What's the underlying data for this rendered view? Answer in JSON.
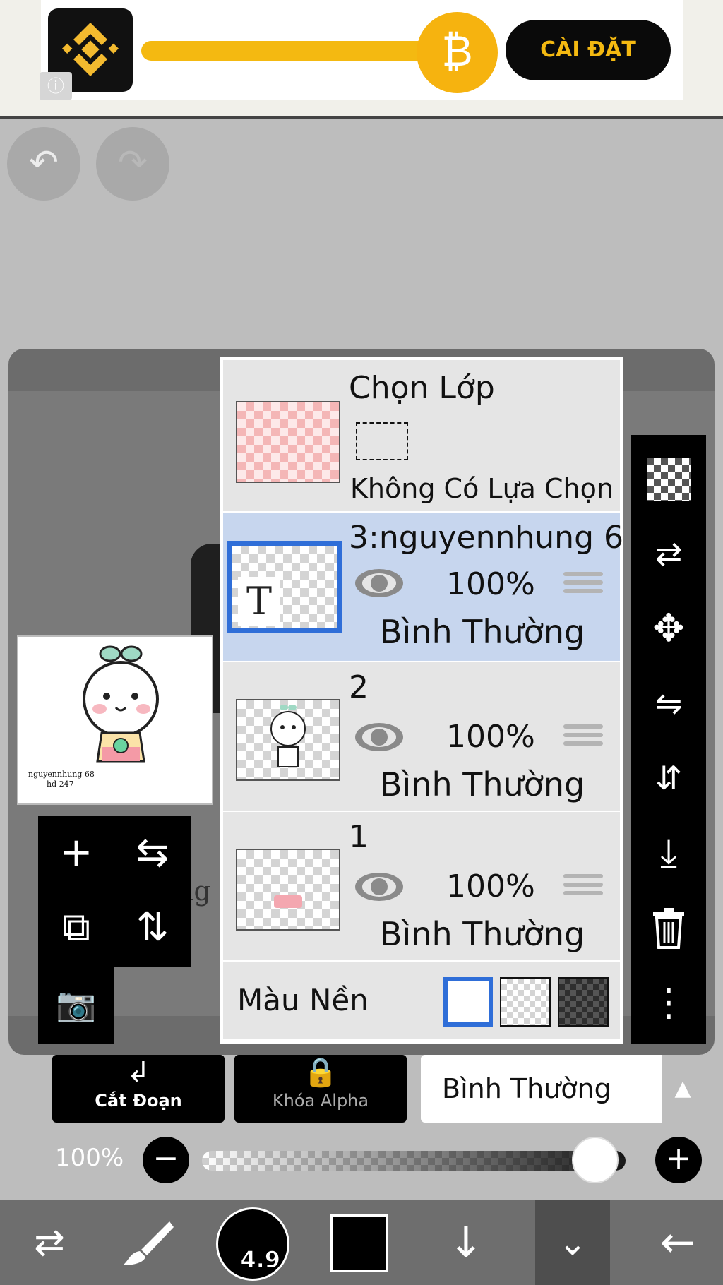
{
  "ad": {
    "coin_symbol": "₿",
    "install_label": "CÀI ĐẶT",
    "info_symbol": "ⓘ",
    "colors": {
      "brand": "#f4b911",
      "logo_bg": "#111111"
    }
  },
  "history": {
    "undo_icon": "↶",
    "redo_icon": "↷"
  },
  "preview": {
    "caption_line1": "nguyennhung 68",
    "caption_line2": "hd 247"
  },
  "canvas": {
    "partial_text": "ng"
  },
  "layers_panel": {
    "selection": {
      "title": "Chọn Lớp",
      "status": "Không Có Lựa Chọn"
    },
    "layers": [
      {
        "name": "3:nguyennhung 6",
        "opacity": "100%",
        "blend": "Bình Thường",
        "selected": true,
        "thumb_text": "T"
      },
      {
        "name": "2",
        "opacity": "100%",
        "blend": "Bình Thường",
        "selected": false
      },
      {
        "name": "1",
        "opacity": "100%",
        "blend": "Bình Thường",
        "selected": false
      }
    ],
    "background": {
      "label": "Màu Nền",
      "options": [
        "white",
        "transparent",
        "dark-checker"
      ],
      "selected": "white"
    },
    "accent_color": "#2f6ed8"
  },
  "left_tools": {
    "add": "+",
    "flip_h": "⇆",
    "add_copy": "⧉",
    "flip_v": "⇅",
    "camera": "📷"
  },
  "right_tools": [
    "checker-icon",
    "swap-icon",
    "move-icon",
    "flip-horizontal-icon",
    "flip-vertical-icon",
    "merge-down-icon",
    "trash-icon",
    "more-icon"
  ],
  "bottom_controls": {
    "clip_label": "Cắt Đoạn",
    "alpha_lock_label": "Khóa Alpha",
    "blend_mode": "Bình Thường",
    "opacity_label": "100%",
    "opacity_value": 1.0
  },
  "toolbar": {
    "brush_size": "4.9",
    "color": "#000000"
  }
}
